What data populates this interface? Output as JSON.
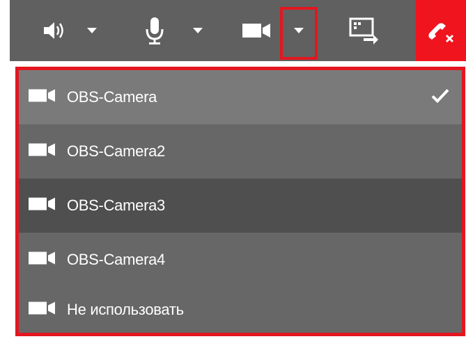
{
  "toolbar": {
    "buttons": [
      {
        "name": "speaker",
        "icon": "speaker-icon"
      },
      {
        "name": "microphone",
        "icon": "microphone-icon"
      },
      {
        "name": "camera",
        "icon": "video-camera-icon"
      },
      {
        "name": "screen-share",
        "icon": "screen-share-icon"
      },
      {
        "name": "hang-up",
        "icon": "hang-up-phone-icon"
      }
    ],
    "dropdown_icon": "chevron-down-icon"
  },
  "camera_menu": {
    "items": [
      {
        "label": "OBS-Camera",
        "selected": true,
        "state": "selected"
      },
      {
        "label": "OBS-Camera2",
        "selected": false,
        "state": "normal"
      },
      {
        "label": "OBS-Camera3",
        "selected": false,
        "state": "hover"
      },
      {
        "label": "OBS-Camera4",
        "selected": false,
        "state": "normal"
      },
      {
        "label": "Не использовать",
        "selected": false,
        "state": "normal"
      }
    ],
    "item_icon": "video-camera-icon",
    "check_icon": "checkmark-icon"
  },
  "colors": {
    "toolbar_bg": "#606060",
    "highlight": "#e3161f",
    "hangup_bg": "#f0141e",
    "item_selected": "#7a7a7a",
    "item_normal": "#676767",
    "item_hover": "#4f4f4f",
    "text": "#ffffff"
  }
}
